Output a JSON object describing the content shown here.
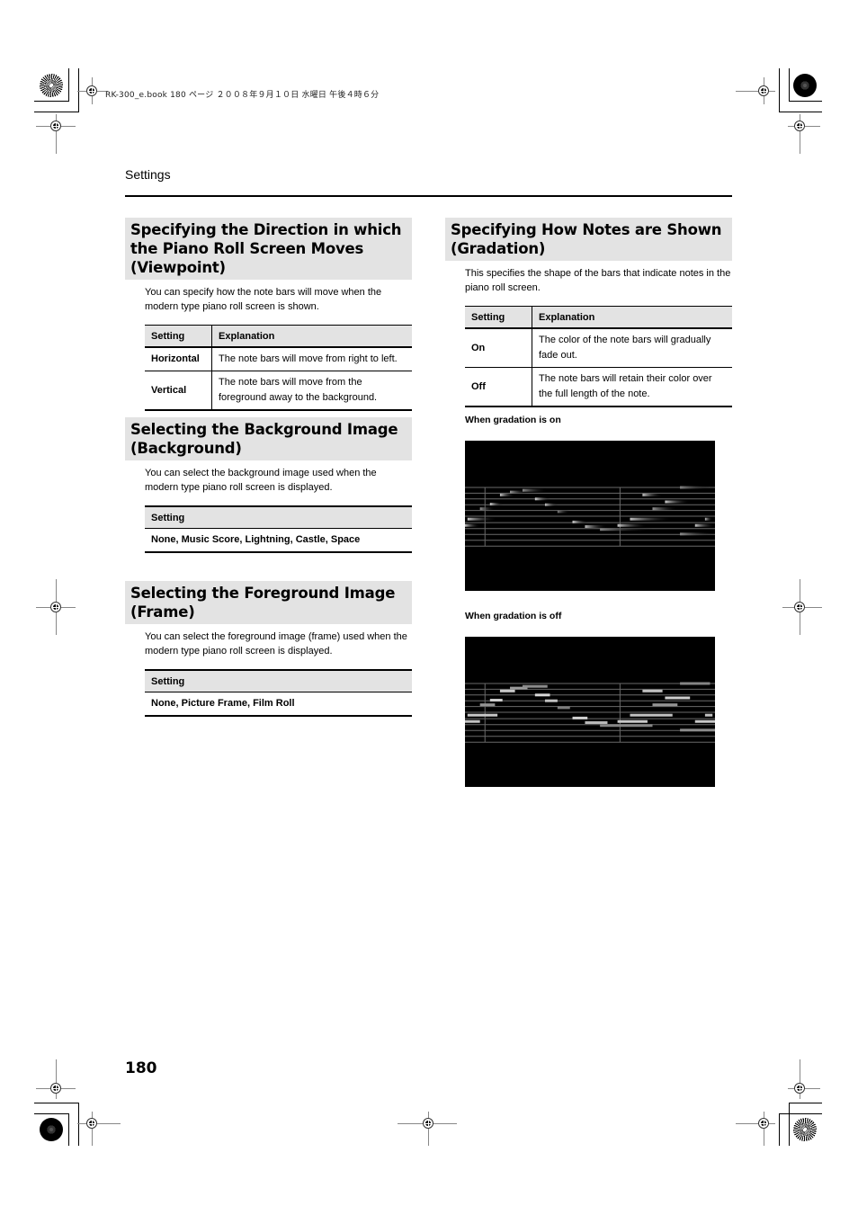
{
  "print_slug": "RK-300_e.book  180 ページ  ２００８年９月１０日  水曜日  午後４時６分",
  "running_header": "Settings",
  "page_number": "180",
  "sections": {
    "viewpoint": {
      "title": "Specifying the Direction in which the Piano Roll Screen Moves (Viewpoint)",
      "description": "You can specify how the note bars will move when the modern type piano roll screen is shown.",
      "table": {
        "headers": [
          "Setting",
          "Explanation"
        ],
        "rows": [
          {
            "setting": "Horizontal",
            "explanation": "The note bars will move from right to left."
          },
          {
            "setting": "Vertical",
            "explanation": "The note bars will move from the foreground away to the background."
          }
        ]
      }
    },
    "background": {
      "title": "Selecting the Background Image (Background)",
      "description": "You can select the background image used when the modern type piano roll screen is displayed.",
      "table": {
        "header": "Setting",
        "value": "None, Music Score, Lightning, Castle, Space"
      }
    },
    "frame": {
      "title": "Selecting the Foreground Image (Frame)",
      "description": "You can select the foreground image (frame) used when the modern type piano roll screen is displayed.",
      "table": {
        "header": "Setting",
        "value": "None, Picture Frame, Film Roll"
      }
    },
    "gradation": {
      "title": "Specifying How Notes are Shown (Gradation)",
      "description": "This specifies the shape of the bars that indicate notes in the piano roll screen.",
      "table": {
        "headers": [
          "Setting",
          "Explanation"
        ],
        "rows": [
          {
            "setting": "On",
            "explanation": "The color of the note bars will gradually fade out."
          },
          {
            "setting": "Off",
            "explanation": "The note bars will retain their color over the full length of the note."
          }
        ]
      },
      "figures": [
        {
          "caption": "When gradation is on",
          "mode": "gradient"
        },
        {
          "caption": "When gradation is off",
          "mode": "solid"
        }
      ]
    }
  },
  "piano_roll": {
    "staff_lines": 11,
    "bar_lines": [
      0.08,
      0.62
    ],
    "notes": [
      {
        "start": 0.0,
        "len": 0.06,
        "row": 6.6,
        "shade": 0.75
      },
      {
        "start": 0.01,
        "len": 0.12,
        "row": 5.5,
        "shade": 0.8
      },
      {
        "start": 0.06,
        "len": 0.06,
        "row": 3.7,
        "shade": 0.45
      },
      {
        "start": 0.1,
        "len": 0.05,
        "row": 2.9,
        "shade": 0.85
      },
      {
        "start": 0.14,
        "len": 0.06,
        "row": 1.3,
        "shade": 0.8
      },
      {
        "start": 0.18,
        "len": 0.07,
        "row": 0.8,
        "shade": 0.5
      },
      {
        "start": 0.23,
        "len": 0.1,
        "row": 0.5,
        "shade": 0.4
      },
      {
        "start": 0.28,
        "len": 0.06,
        "row": 2.0,
        "shade": 0.9
      },
      {
        "start": 0.32,
        "len": 0.05,
        "row": 3.0,
        "shade": 0.75
      },
      {
        "start": 0.37,
        "len": 0.05,
        "row": 4.2,
        "shade": 0.3
      },
      {
        "start": 0.43,
        "len": 0.06,
        "row": 6.0,
        "shade": 0.85
      },
      {
        "start": 0.48,
        "len": 0.09,
        "row": 6.8,
        "shade": 0.7
      },
      {
        "start": 0.54,
        "len": 0.21,
        "row": 7.3,
        "shade": 0.35
      },
      {
        "start": 0.61,
        "len": 0.12,
        "row": 6.6,
        "shade": 0.8
      },
      {
        "start": 0.66,
        "len": 0.17,
        "row": 5.5,
        "shade": 0.75
      },
      {
        "start": 0.71,
        "len": 0.08,
        "row": 1.3,
        "shade": 0.75
      },
      {
        "start": 0.75,
        "len": 0.1,
        "row": 3.7,
        "shade": 0.45
      },
      {
        "start": 0.8,
        "len": 0.1,
        "row": 2.5,
        "shade": 0.85
      },
      {
        "start": 0.86,
        "len": 0.12,
        "row": 0.0,
        "shade": 0.35
      },
      {
        "start": 0.86,
        "len": 0.14,
        "row": 8.1,
        "shade": 0.4
      },
      {
        "start": 0.92,
        "len": 0.08,
        "row": 6.6,
        "shade": 0.8
      },
      {
        "start": 0.96,
        "len": 0.03,
        "row": 5.5,
        "shade": 0.75
      }
    ]
  }
}
